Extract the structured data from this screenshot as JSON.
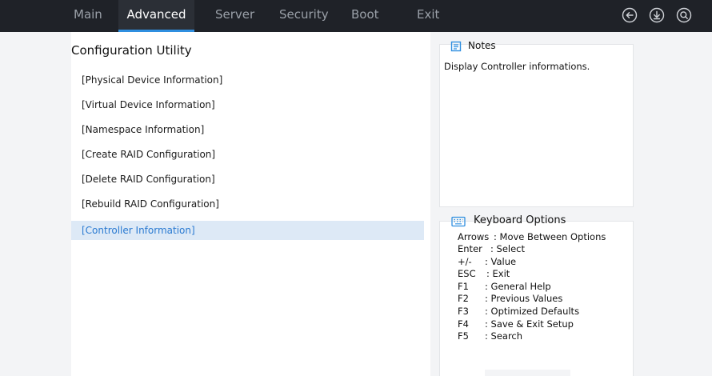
{
  "nav": {
    "tabs": [
      {
        "label": "Main",
        "active": false
      },
      {
        "label": "Advanced",
        "active": true
      },
      {
        "label": "Server",
        "active": false
      },
      {
        "label": "Security",
        "active": false
      },
      {
        "label": "Boot",
        "active": false
      },
      {
        "label": "Exit",
        "active": false
      }
    ],
    "icons": [
      "back-arrow-icon",
      "download-icon",
      "search-icon"
    ],
    "accent_color": "#2f8fe0"
  },
  "main": {
    "title": "Configuration Utility",
    "items": [
      "[Physical Device Information]",
      "[Virtual Device Information]",
      "[Namespace Information]",
      "[Create RAID Configuration]",
      "[Delete RAID Configuration]",
      "[Rebuild RAID Configuration]",
      "[Controller Information]"
    ],
    "selected_index": 6
  },
  "notes": {
    "title": "Notes",
    "text": "Display Controller informations."
  },
  "keyboard": {
    "title": "Keyboard Options",
    "options": [
      {
        "key": "Arrows",
        "desc": ": Move Between Options"
      },
      {
        "key": "Enter",
        "desc": ": Select"
      },
      {
        "key": "+/-",
        "desc": ": Value"
      },
      {
        "key": "ESC",
        "desc": ": Exit"
      },
      {
        "key": "F1",
        "desc": ": General Help"
      },
      {
        "key": "F2",
        "desc": ": Previous Values"
      },
      {
        "key": "F3",
        "desc": ": Optimized Defaults"
      },
      {
        "key": "F4",
        "desc": ": Save & Exit Setup"
      },
      {
        "key": "F5",
        "desc": ": Search"
      }
    ]
  }
}
